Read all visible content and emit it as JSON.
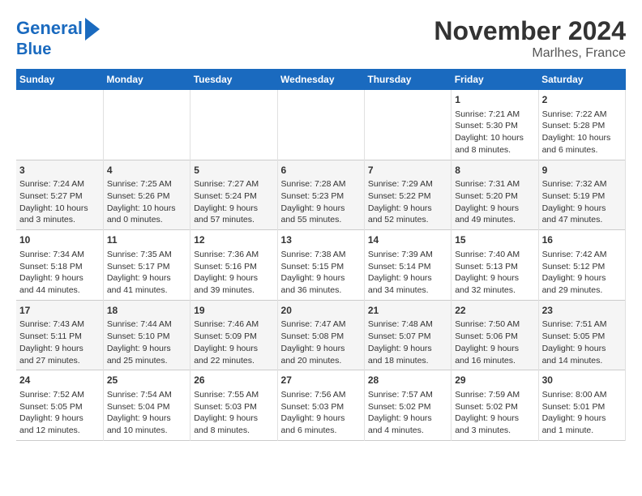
{
  "header": {
    "logo_line1": "General",
    "logo_line2": "Blue",
    "month": "November 2024",
    "location": "Marlhes, France"
  },
  "weekdays": [
    "Sunday",
    "Monday",
    "Tuesday",
    "Wednesday",
    "Thursday",
    "Friday",
    "Saturday"
  ],
  "weeks": [
    [
      {
        "day": "",
        "info": ""
      },
      {
        "day": "",
        "info": ""
      },
      {
        "day": "",
        "info": ""
      },
      {
        "day": "",
        "info": ""
      },
      {
        "day": "",
        "info": ""
      },
      {
        "day": "1",
        "info": "Sunrise: 7:21 AM\nSunset: 5:30 PM\nDaylight: 10 hours\nand 8 minutes."
      },
      {
        "day": "2",
        "info": "Sunrise: 7:22 AM\nSunset: 5:28 PM\nDaylight: 10 hours\nand 6 minutes."
      }
    ],
    [
      {
        "day": "3",
        "info": "Sunrise: 7:24 AM\nSunset: 5:27 PM\nDaylight: 10 hours\nand 3 minutes."
      },
      {
        "day": "4",
        "info": "Sunrise: 7:25 AM\nSunset: 5:26 PM\nDaylight: 10 hours\nand 0 minutes."
      },
      {
        "day": "5",
        "info": "Sunrise: 7:27 AM\nSunset: 5:24 PM\nDaylight: 9 hours\nand 57 minutes."
      },
      {
        "day": "6",
        "info": "Sunrise: 7:28 AM\nSunset: 5:23 PM\nDaylight: 9 hours\nand 55 minutes."
      },
      {
        "day": "7",
        "info": "Sunrise: 7:29 AM\nSunset: 5:22 PM\nDaylight: 9 hours\nand 52 minutes."
      },
      {
        "day": "8",
        "info": "Sunrise: 7:31 AM\nSunset: 5:20 PM\nDaylight: 9 hours\nand 49 minutes."
      },
      {
        "day": "9",
        "info": "Sunrise: 7:32 AM\nSunset: 5:19 PM\nDaylight: 9 hours\nand 47 minutes."
      }
    ],
    [
      {
        "day": "10",
        "info": "Sunrise: 7:34 AM\nSunset: 5:18 PM\nDaylight: 9 hours\nand 44 minutes."
      },
      {
        "day": "11",
        "info": "Sunrise: 7:35 AM\nSunset: 5:17 PM\nDaylight: 9 hours\nand 41 minutes."
      },
      {
        "day": "12",
        "info": "Sunrise: 7:36 AM\nSunset: 5:16 PM\nDaylight: 9 hours\nand 39 minutes."
      },
      {
        "day": "13",
        "info": "Sunrise: 7:38 AM\nSunset: 5:15 PM\nDaylight: 9 hours\nand 36 minutes."
      },
      {
        "day": "14",
        "info": "Sunrise: 7:39 AM\nSunset: 5:14 PM\nDaylight: 9 hours\nand 34 minutes."
      },
      {
        "day": "15",
        "info": "Sunrise: 7:40 AM\nSunset: 5:13 PM\nDaylight: 9 hours\nand 32 minutes."
      },
      {
        "day": "16",
        "info": "Sunrise: 7:42 AM\nSunset: 5:12 PM\nDaylight: 9 hours\nand 29 minutes."
      }
    ],
    [
      {
        "day": "17",
        "info": "Sunrise: 7:43 AM\nSunset: 5:11 PM\nDaylight: 9 hours\nand 27 minutes."
      },
      {
        "day": "18",
        "info": "Sunrise: 7:44 AM\nSunset: 5:10 PM\nDaylight: 9 hours\nand 25 minutes."
      },
      {
        "day": "19",
        "info": "Sunrise: 7:46 AM\nSunset: 5:09 PM\nDaylight: 9 hours\nand 22 minutes."
      },
      {
        "day": "20",
        "info": "Sunrise: 7:47 AM\nSunset: 5:08 PM\nDaylight: 9 hours\nand 20 minutes."
      },
      {
        "day": "21",
        "info": "Sunrise: 7:48 AM\nSunset: 5:07 PM\nDaylight: 9 hours\nand 18 minutes."
      },
      {
        "day": "22",
        "info": "Sunrise: 7:50 AM\nSunset: 5:06 PM\nDaylight: 9 hours\nand 16 minutes."
      },
      {
        "day": "23",
        "info": "Sunrise: 7:51 AM\nSunset: 5:05 PM\nDaylight: 9 hours\nand 14 minutes."
      }
    ],
    [
      {
        "day": "24",
        "info": "Sunrise: 7:52 AM\nSunset: 5:05 PM\nDaylight: 9 hours\nand 12 minutes."
      },
      {
        "day": "25",
        "info": "Sunrise: 7:54 AM\nSunset: 5:04 PM\nDaylight: 9 hours\nand 10 minutes."
      },
      {
        "day": "26",
        "info": "Sunrise: 7:55 AM\nSunset: 5:03 PM\nDaylight: 9 hours\nand 8 minutes."
      },
      {
        "day": "27",
        "info": "Sunrise: 7:56 AM\nSunset: 5:03 PM\nDaylight: 9 hours\nand 6 minutes."
      },
      {
        "day": "28",
        "info": "Sunrise: 7:57 AM\nSunset: 5:02 PM\nDaylight: 9 hours\nand 4 minutes."
      },
      {
        "day": "29",
        "info": "Sunrise: 7:59 AM\nSunset: 5:02 PM\nDaylight: 9 hours\nand 3 minutes."
      },
      {
        "day": "30",
        "info": "Sunrise: 8:00 AM\nSunset: 5:01 PM\nDaylight: 9 hours\nand 1 minute."
      }
    ]
  ]
}
